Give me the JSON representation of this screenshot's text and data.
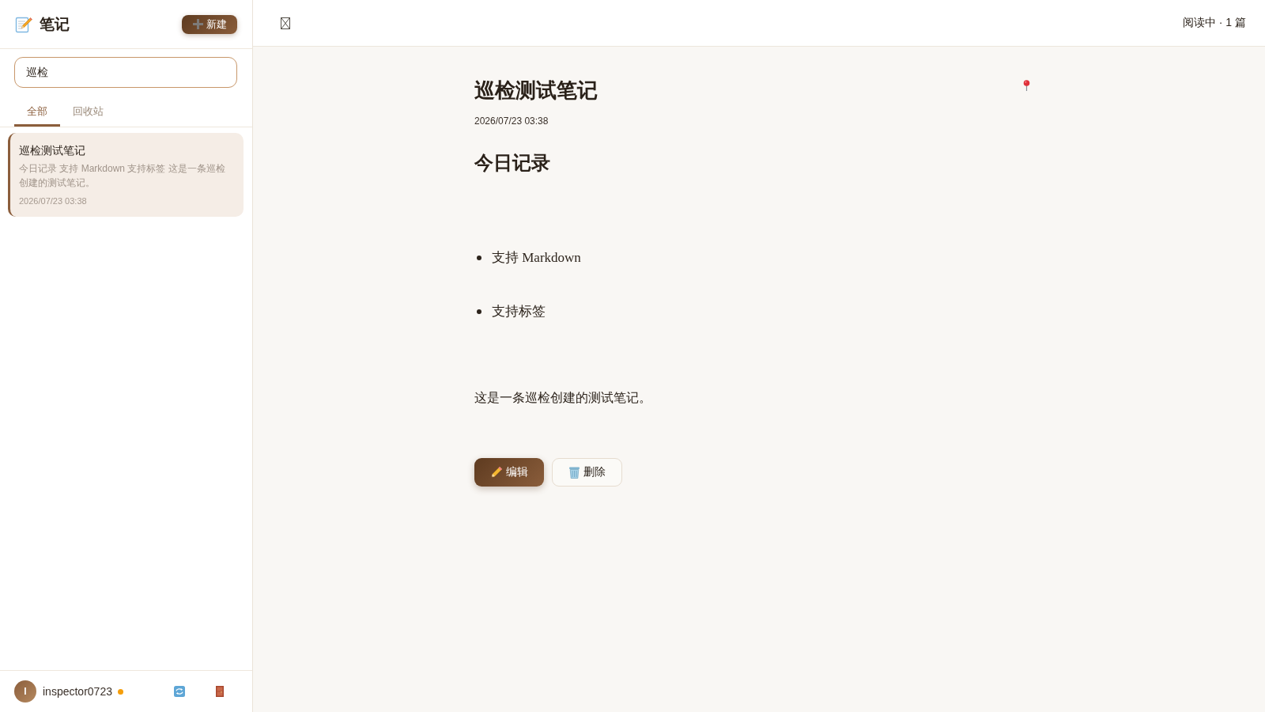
{
  "sidebar": {
    "title": "笔记",
    "new_button": "新建",
    "search": {
      "value": "巡检"
    },
    "tabs": [
      {
        "label": "全部",
        "selected": true
      },
      {
        "label": "回收站",
        "selected": false
      }
    ],
    "notes": [
      {
        "title": "巡检测试笔记",
        "preview": "今日记录 支持 Markdown 支持标签 这是一条巡检创建的测试笔记。",
        "date": "2026/07/23 03:38",
        "selected": true
      }
    ],
    "user": {
      "avatar_initial": "I",
      "name": "inspector0723",
      "color": "#f59e0b"
    }
  },
  "topbar": {
    "status": "阅读中 · 1 篇"
  },
  "note": {
    "title": "巡检测试笔记",
    "pinned": true,
    "date": "2026/07/23 03:38",
    "blocks": [
      {
        "kind": "heading",
        "text": "今日记录"
      },
      {
        "kind": "bullet",
        "text": "支持 Markdown"
      },
      {
        "kind": "bullet",
        "text": "支持标签"
      },
      {
        "kind": "paragraph",
        "text": "这是一条巡检创建的测试笔记。"
      }
    ]
  },
  "actions": [
    {
      "kind": "edit",
      "label": "编辑"
    },
    {
      "kind": "delete",
      "label": "删除"
    }
  ]
}
